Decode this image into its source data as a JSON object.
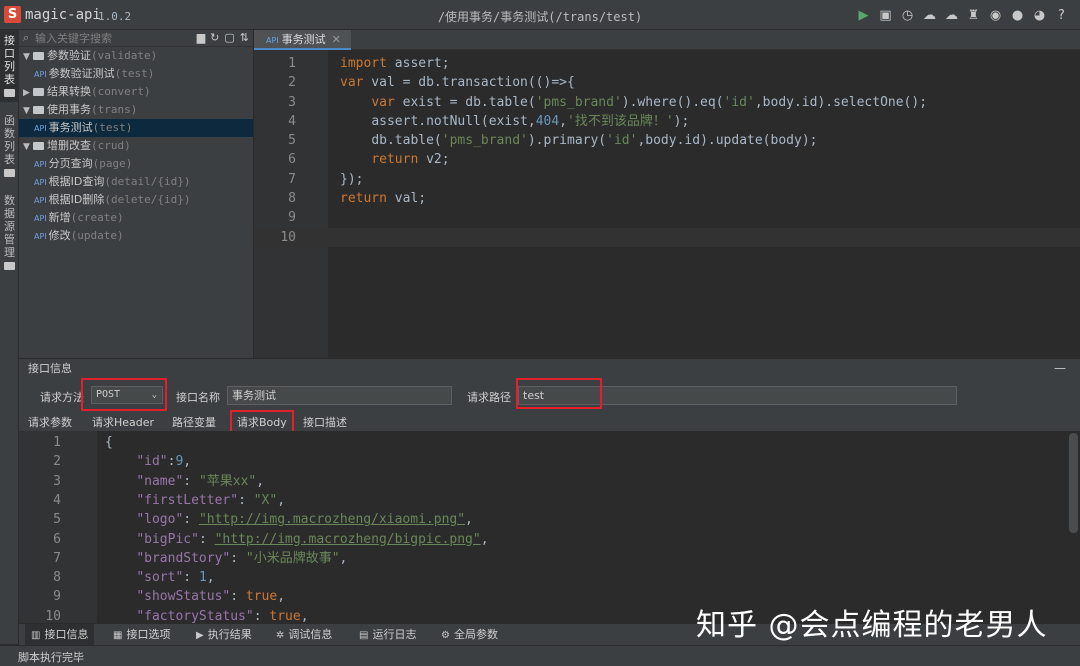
{
  "app": {
    "logo_letter": "S",
    "name": "magic-api",
    "version": "1.0.2",
    "window_title": "/使用事务/事务测试(/trans/test)"
  },
  "toolbar_icons": [
    "run-icon",
    "save-icon",
    "history-icon",
    "upload-icon",
    "download-icon",
    "skin-icon",
    "gitee-icon",
    "github-icon",
    "qq-icon",
    "help-icon"
  ],
  "vertical_tabs": [
    {
      "label": "接口列表",
      "active": true
    },
    {
      "label": "函数列表",
      "active": false
    },
    {
      "label": "数据源管理",
      "active": false
    }
  ],
  "tree": {
    "search_placeholder": "输入关键字搜索",
    "items": [
      {
        "type": "group",
        "expanded": true,
        "name": "参数验证",
        "path": "(validate)"
      },
      {
        "type": "api",
        "name": "参数验证测试",
        "path": "(test)",
        "selected": false
      },
      {
        "type": "group",
        "expanded": false,
        "name": "结果转换",
        "path": "(convert)"
      },
      {
        "type": "group",
        "expanded": true,
        "name": "使用事务",
        "path": "(trans)"
      },
      {
        "type": "api",
        "name": "事务测试",
        "path": "(test)",
        "selected": true
      },
      {
        "type": "group",
        "expanded": true,
        "name": "增删改查",
        "path": "(crud)"
      },
      {
        "type": "api",
        "name": "分页查询",
        "path": "(page)",
        "selected": false
      },
      {
        "type": "api",
        "name": "根据ID查询",
        "path": "(detail/{id})",
        "selected": false
      },
      {
        "type": "api",
        "name": "根据ID删除",
        "path": "(delete/{id})",
        "selected": false
      },
      {
        "type": "api",
        "name": "新增",
        "path": "(create)",
        "selected": false
      },
      {
        "type": "api",
        "name": "修改",
        "path": "(update)",
        "selected": false
      }
    ]
  },
  "editor": {
    "tab_label": "事务测试",
    "tab_tag": "API",
    "close_glyph": "✕",
    "lines": [
      "1",
      "2",
      "3",
      "4",
      "5",
      "6",
      "7",
      "8",
      "9",
      "10"
    ],
    "code": {
      "l1_kw": "import",
      "l1_rest": " assert;",
      "l2_kw": "var",
      "l2_rest": " val = db.transaction(()=>{",
      "l3_kw": "var",
      "l3_a": " exist = db.table(",
      "l3_s1": "'pms_brand'",
      "l3_b": ").where().eq(",
      "l3_s2": "'id'",
      "l3_c": ",body.id).selectOne();",
      "l4_a": "assert.notNull(exist,",
      "l4_n": "404",
      "l4_b": ",",
      "l4_s": "'找不到该品牌！'",
      "l4_c": ");",
      "l5_a": "db.table(",
      "l5_s1": "'pms_brand'",
      "l5_b": ").primary(",
      "l5_s2": "'id'",
      "l5_c": ",body.id).update(body);",
      "l6_kw": "return",
      "l6_rest": " v2;",
      "l7": "});",
      "l8_kw": "return",
      "l8_rest": " val;"
    }
  },
  "info": {
    "title": "接口信息",
    "minimize": "—",
    "method_label": "请求方法",
    "method_value": "POST",
    "name_label": "接口名称",
    "name_value": "事务测试",
    "path_label": "请求路径",
    "path_value": "test",
    "subtabs": [
      "请求参数",
      "请求Header",
      "路径变量",
      "请求Body",
      "接口描述"
    ]
  },
  "body_json": {
    "lines": [
      "1",
      "2",
      "3",
      "4",
      "5",
      "6",
      "7",
      "8",
      "9",
      "10"
    ],
    "open": "{",
    "entries": [
      {
        "key": "\"id\"",
        "sep": ":",
        "val": "9",
        "vtype": "num",
        "tail": ","
      },
      {
        "key": "\"name\"",
        "sep": ": ",
        "val": "\"苹果xx\"",
        "vtype": "str",
        "tail": ","
      },
      {
        "key": "\"firstLetter\"",
        "sep": ": ",
        "val": "\"X\"",
        "vtype": "str",
        "tail": ","
      },
      {
        "key": "\"logo\"",
        "sep": ": ",
        "val": "\"http://img.macrozheng/xiaomi.png\"",
        "vtype": "url",
        "tail": ","
      },
      {
        "key": "\"bigPic\"",
        "sep": ": ",
        "val": "\"http://img.macrozheng/bigpic.png\"",
        "vtype": "url",
        "tail": ","
      },
      {
        "key": "\"brandStory\"",
        "sep": ": ",
        "val": "\"小米品牌故事\"",
        "vtype": "str",
        "tail": ","
      },
      {
        "key": "\"sort\"",
        "sep": ": ",
        "val": "1",
        "vtype": "num",
        "tail": ","
      },
      {
        "key": "\"showStatus\"",
        "sep": ": ",
        "val": "true",
        "vtype": "bool",
        "tail": ","
      },
      {
        "key": "\"factoryStatus\"",
        "sep": ": ",
        "val": "true",
        "vtype": "bool",
        "tail": ","
      }
    ]
  },
  "bottom_tabs": [
    {
      "label": "接口信息",
      "icon": "info-icon",
      "active": true
    },
    {
      "label": "接口选项",
      "icon": "grid-icon",
      "active": false
    },
    {
      "label": "执行结果",
      "icon": "play-icon",
      "active": false
    },
    {
      "label": "调试信息",
      "icon": "bug-icon",
      "active": false
    },
    {
      "label": "运行日志",
      "icon": "log-icon",
      "active": false
    },
    {
      "label": "全局参数",
      "icon": "gear-icon",
      "active": false
    }
  ],
  "status": "脚本执行完毕",
  "watermark": "知乎 @会点编程的老男人"
}
